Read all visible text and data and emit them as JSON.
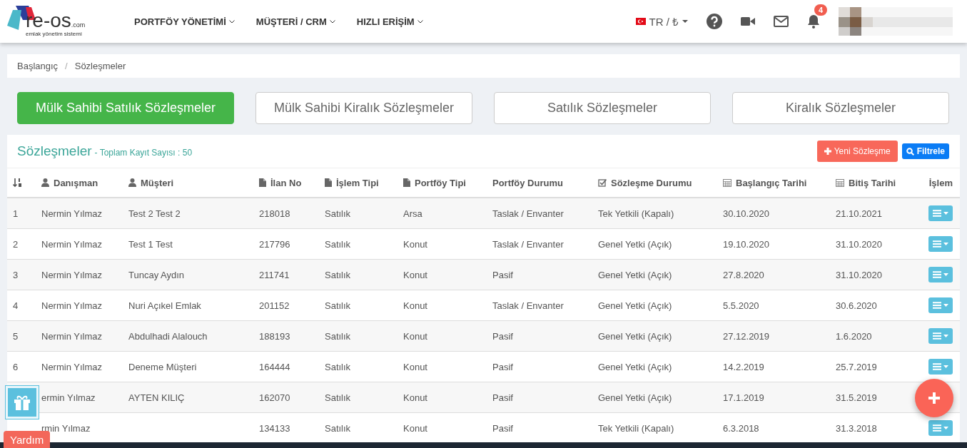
{
  "logo": {
    "name": "re-os",
    "suffix": ".com",
    "tagline": "emlak yönetim sistemi"
  },
  "nav": [
    {
      "label": "PORTFÖY YÖNETİMİ"
    },
    {
      "label": "MÜŞTERİ / CRM"
    },
    {
      "label": "HIZLI ERİŞİM"
    }
  ],
  "locale": "TR / ₺",
  "notifications": "4",
  "breadcrumb": [
    "Başlangıç",
    "/",
    "Sözleşmeler"
  ],
  "tabs": [
    {
      "label": "Mülk Sahibi Satılık Sözleşmeler",
      "selected": true
    },
    {
      "label": "Mülk Sahibi Kiralık Sözleşmeler",
      "selected": false
    },
    {
      "label": "Satılık Sözleşmeler",
      "selected": false
    },
    {
      "label": "Kiralık Sözleşmeler",
      "selected": false
    }
  ],
  "panel": {
    "title": "Sözleşmeler",
    "subtitle": "- Toplam Kayıt Sayısı : 50",
    "new_button": "Yeni Sözleşme",
    "filter_button": "Filtrele"
  },
  "table": {
    "columns": [
      "Danışman",
      "Müşteri",
      "İlan No",
      "İşlem Tipi",
      "Portföy Tipi",
      "Portföy Durumu",
      "Sözleşme Durumu",
      "Başlangıç Tarihi",
      "Bitiş Tarihi",
      "İşlem"
    ],
    "rows": [
      {
        "no": "1",
        "cells": [
          "Nermin Yılmaz",
          "Test 2 Test 2",
          "218018",
          "Satılık",
          "Arsa",
          "Taslak / Envanter",
          "Tek Yetkili (Kapalı)",
          "30.10.2020",
          "21.10.2021"
        ]
      },
      {
        "no": "2",
        "cells": [
          "Nermin Yılmaz",
          "Test 1 Test",
          "217796",
          "Satılık",
          "Konut",
          "Taslak / Envanter",
          "Genel Yetki (Açık)",
          "19.10.2020",
          "31.10.2020"
        ]
      },
      {
        "no": "3",
        "cells": [
          "Nermin Yılmaz",
          "Tuncay Aydın",
          "211741",
          "Satılık",
          "Konut",
          "Pasif",
          "Genel Yetki (Açık)",
          "27.8.2020",
          "31.10.2020"
        ]
      },
      {
        "no": "4",
        "cells": [
          "Nermin Yılmaz",
          "Nuri Açıkel Emlak",
          "201152",
          "Satılık",
          "Konut",
          "Taslak / Envanter",
          "Genel Yetki (Açık)",
          "5.5.2020",
          "30.6.2020"
        ]
      },
      {
        "no": "5",
        "cells": [
          "Nermin Yılmaz",
          "Abdulhadi Alalouch",
          "188193",
          "Satılık",
          "Konut",
          "Pasif",
          "Genel Yetki (Açık)",
          "27.12.2019",
          "1.6.2020"
        ]
      },
      {
        "no": "6",
        "cells": [
          "Nermin Yılmaz",
          "Deneme Müşteri",
          "164444",
          "Satılık",
          "Konut",
          "Pasif",
          "Genel Yetki (Açık)",
          "14.2.2019",
          "25.7.2019"
        ]
      },
      {
        "actions_hidden": true,
        "cells": [
          "ermin Yılmaz",
          "AYTEN KILIÇ",
          "162070",
          "Satılık",
          "Konut",
          "Pasif",
          "Genel Yetki (Açık)",
          "17.1.2019",
          "31.5.2019"
        ]
      },
      {
        "cells": [
          "rmin Yılmaz",
          "",
          "134133",
          "Satılık",
          "Konut",
          "Pasif",
          "Tek Yetkili (Kapalı)",
          "6.3.2018",
          "31.3.2018"
        ]
      }
    ]
  },
  "help_button": "Yardım"
}
